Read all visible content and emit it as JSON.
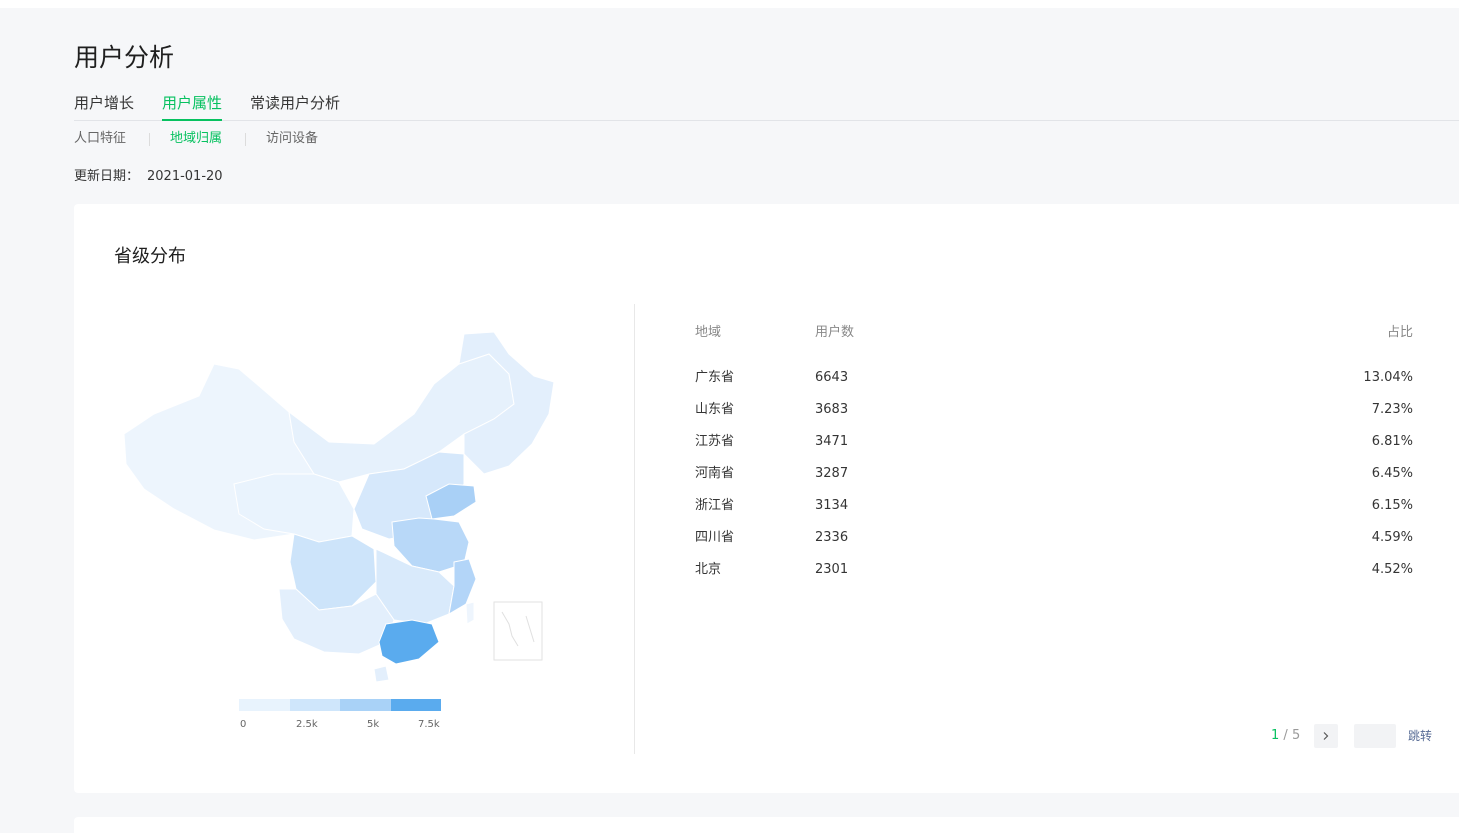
{
  "page": {
    "title": "用户分析"
  },
  "tabs": [
    {
      "label": "用户增长"
    },
    {
      "label": "用户属性"
    },
    {
      "label": "常读用户分析"
    }
  ],
  "subtabs": [
    {
      "label": "人口特征"
    },
    {
      "label": "地域归属"
    },
    {
      "label": "访问设备"
    }
  ],
  "update": {
    "label": "更新日期：",
    "date": "2021-01-20"
  },
  "card": {
    "title": "省级分布"
  },
  "legend": {
    "labels": [
      "0",
      "2.5k",
      "5k",
      "7.5k"
    ],
    "colors": [
      "#e8f3fd",
      "#cfe6fb",
      "#a9d2f7",
      "#5aabee"
    ],
    "max": 7500
  },
  "table": {
    "headers": {
      "region": "地域",
      "users": "用户数",
      "share": "占比"
    },
    "rows": [
      {
        "region": "广东省",
        "users": "6643",
        "share": "13.04%"
      },
      {
        "region": "山东省",
        "users": "3683",
        "share": "7.23%"
      },
      {
        "region": "江苏省",
        "users": "3471",
        "share": "6.81%"
      },
      {
        "region": "河南省",
        "users": "3287",
        "share": "6.45%"
      },
      {
        "region": "浙江省",
        "users": "3134",
        "share": "6.15%"
      },
      {
        "region": "四川省",
        "users": "2336",
        "share": "4.59%"
      },
      {
        "region": "北京",
        "users": "2301",
        "share": "4.52%"
      }
    ]
  },
  "pagination": {
    "current": "1",
    "separator": "/",
    "total": "5",
    "next_icon": "chevron-right-icon",
    "input_value": "",
    "jump_label": "跳转"
  },
  "colors": {
    "accent": "#07c160",
    "map_base": "#e8f2fc",
    "map_highlight": "#5aabee"
  }
}
